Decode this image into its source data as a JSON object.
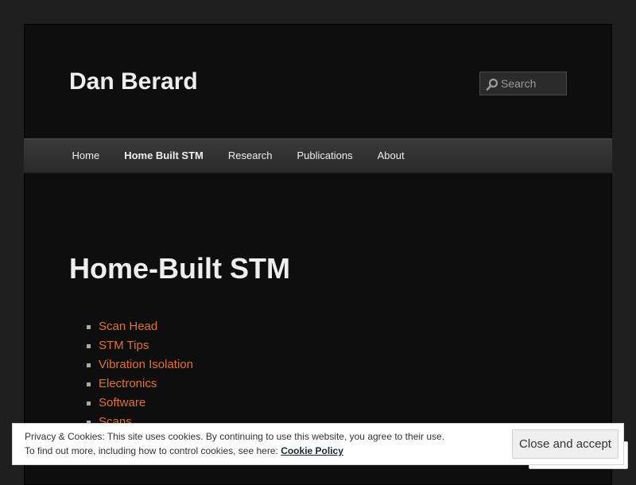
{
  "header": {
    "site_title": "Dan Berard",
    "search": {
      "placeholder": "Search",
      "icon": "search-icon"
    }
  },
  "nav": {
    "items": [
      {
        "label": "Home"
      },
      {
        "label": "Home Built STM",
        "current": true
      },
      {
        "label": "Research"
      },
      {
        "label": "Publications"
      },
      {
        "label": "About"
      }
    ]
  },
  "main": {
    "title": "Home-Built STM",
    "links": [
      "Scan Head",
      "STM Tips",
      "Vibration Isolation",
      "Electronics",
      "Software",
      "Scans"
    ]
  },
  "cookie_banner": {
    "line1": "Privacy & Cookies: This site uses cookies. By continuing to use this website, you agree to their use.",
    "line2_prefix": "To find out more, including how to control cookies, see here:",
    "policy_link": "Cookie Policy",
    "accept_label": "Close and accept"
  },
  "colors": {
    "background": "#1f1f1f",
    "page": "#0e0e0e",
    "link": "#e2702e",
    "text": "#eeeeee"
  }
}
